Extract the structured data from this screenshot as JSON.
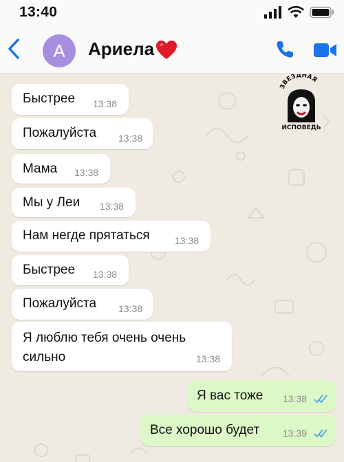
{
  "status_bar": {
    "time": "13:40",
    "icons": [
      "signal-icon",
      "wifi-icon",
      "battery-icon"
    ]
  },
  "header": {
    "avatar_letter": "A",
    "contact_name": "Ариела",
    "name_emoji": "red-heart-icon",
    "actions": [
      "phone-call-icon",
      "video-call-icon"
    ]
  },
  "watermark": {
    "line1": "ЗВЕЗДНАЯ",
    "line2": "ИСПОВЕДЬ"
  },
  "messages": [
    {
      "direction": "in",
      "text": "Быстрее",
      "time": "13:38"
    },
    {
      "direction": "in",
      "text": "Пожалуйста",
      "time": "13:38"
    },
    {
      "direction": "in",
      "text": "Мама",
      "time": "13:38"
    },
    {
      "direction": "in",
      "text": "Мы у Леи",
      "time": "13:38"
    },
    {
      "direction": "in",
      "text": "Нам негде прятаться",
      "time": "13:38"
    },
    {
      "direction": "in",
      "text": "Быстрее",
      "time": "13:38"
    },
    {
      "direction": "in",
      "text": "Пожалуйста",
      "time": "13:38"
    },
    {
      "direction": "in",
      "text": "Я люблю тебя очень очень сильно",
      "time": "13:38"
    },
    {
      "direction": "out",
      "text": "Я вас тоже",
      "time": "13:38",
      "status": "read"
    },
    {
      "direction": "out",
      "text": "Все хорошо будет",
      "time": "13:39",
      "status": "read"
    }
  ],
  "colors": {
    "incoming_bubble": "#ffffff",
    "outgoing_bubble": "#dcf8c6",
    "accent_blue": "#1a73e8",
    "avatar_bg": "#a88ee0",
    "read_ticks": "#4fa3e0"
  }
}
